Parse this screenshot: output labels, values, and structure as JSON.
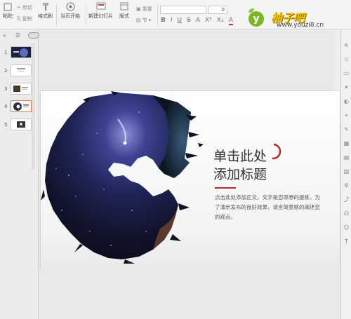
{
  "ribbon": {
    "paste_label": "粘贴",
    "cut_label": "剪切",
    "copy_label": "复制",
    "format_painter_label": "格式刷",
    "from_current_label": "当页开始",
    "new_slide_label": "新建幻灯片",
    "layout_label": "版式",
    "section_label": "节",
    "reset_label": "重置",
    "font_size_value": "0",
    "format_buttons": [
      "B",
      "I",
      "U",
      "S",
      "A",
      "X²",
      "X₂",
      "A"
    ]
  },
  "watermark": {
    "badge": "y",
    "title": "柚子吧",
    "url": "www.youzi8.cn"
  },
  "panel": {
    "thumbnails": [
      {
        "num": "1"
      },
      {
        "num": "2"
      },
      {
        "num": "3"
      },
      {
        "num": "4"
      },
      {
        "num": "5"
      }
    ]
  },
  "slide": {
    "title_line1": "单击此处",
    "title_line2": "添加标题",
    "body": "点击此处添加正文，文字是您思想的提炼，为了演示发布的良好效果，请言简意赅的阐述您的观点。"
  },
  "colors": {
    "accent": "#b52a2a",
    "selection": "#e07b3c",
    "logo_green": "#7bb624",
    "logo_yellow": "#f2c200"
  }
}
